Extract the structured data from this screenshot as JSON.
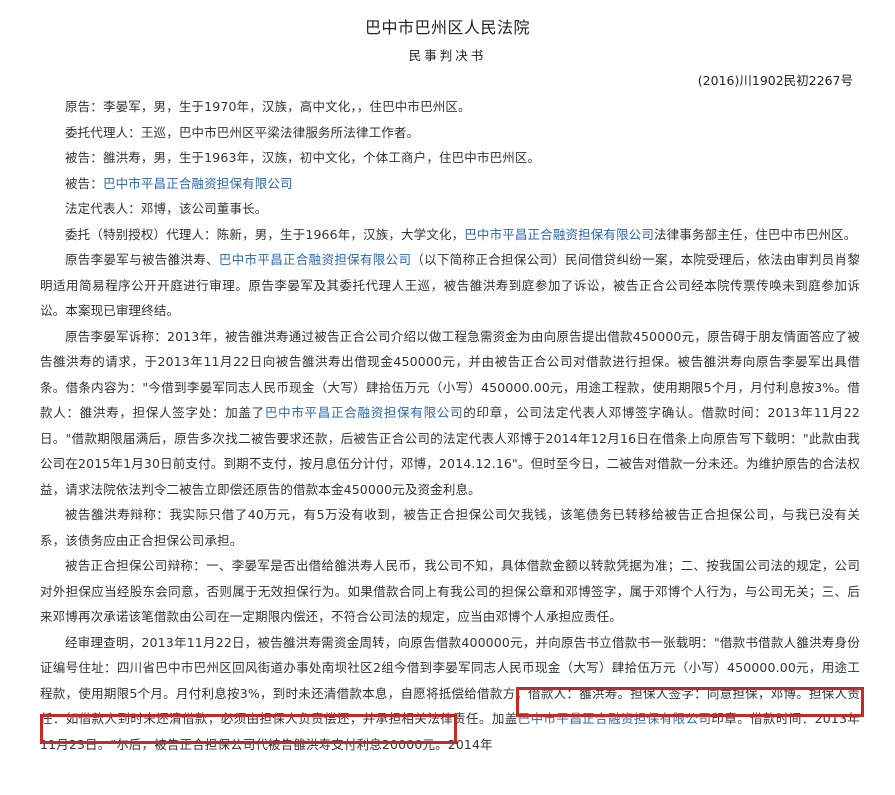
{
  "header": {
    "court": "巴中市巴州区人民法院",
    "doc_type": "民事判决书",
    "case_no": "(2016)川1902民初2267号"
  },
  "parties": {
    "p1": "原告：李晏军，男，生于1970年，汉族，高中文化，，住巴中市巴州区。",
    "p2": "委托代理人：王巡，巴中市巴州区平梁法律服务所法律工作者。",
    "p3": "被告：雒洪寿，男，生于1963年，汉族，初中文化，个体工商户，住巴中市巴州区。",
    "p4_a": "被告：",
    "company": "巴中市平昌正合融资担保有限公司",
    "p5": "法定代表人：邓博，该公司董事长。",
    "p6_a": "委托（特别授权）代理人：陈新，男，生于1966年，汉族，大学文化，",
    "p6_b": "法律事务部主任，住巴中市巴州区。"
  },
  "paragraphs": {
    "p7_a": "原告李晏军与被告雒洪寿、",
    "p7_b": "（以下简称正合担保公司）民间借贷纠纷一案，本院受理后，依法由审判员肖黎明适用简易程序公开开庭进行审理。原告李晏军及其委托代理人王巡，被告雒洪寿到庭参加了诉讼，被告正合公司经本院传票传唤未到庭参加诉讼。本案现已审理终结。",
    "p8_a": "原告李晏军诉称：2013年，被告雒洪寿通过被告正合公司介绍以做工程急需资金为由向原告提出借款450000元，原告碍于朋友情面答应了被告雒洪寿的请求，于2013年11月22日向被告雒洪寿出借现金450000元，并由被告正合公司对借款进行担保。被告雒洪寿向原告李晏军出具借条。借条内容为：\"今借到李晏军同志人民币现金（大写）肆拾伍万元（小写）450000.00元，用途工程款，使用期限5个月，月付利息按3%。借款人：雒洪寿，担保人签字处：加盖了",
    "p8_b": "的印章，公司法定代表人邓博签字确认。借款时间：2013年11月22日。\"借款期限届满后，原告多次找二被告要求还款，后被告正合公司的法定代表人邓博于2014年12月16日在借条上向原告写下载明：\"此款由我公司在2015年1月30日前支付。到期不支付，按月息伍分计付，邓博，2014.12.16\"。但时至今日，二被告对借款一分未还。为维护原告的合法权益，请求法院依法判令二被告立即偿还原告的借款本金450000元及资金利息。",
    "p9": "被告雒洪寿辩称：我实际只借了40万元，有5万没有收到，被告正合担保公司欠我钱，该笔债务已转移给被告正合担保公司，与我已没有关系，该债务应由正合担保公司承担。",
    "p10": "被告正合担保公司辩称：一、李晏军是否出借给雒洪寿人民币，我公司不知，具体借款金额以转款凭据为准；二、按我国公司法的规定，公司对外担保应当经股东会同意，否则属于无效担保行为。如果借款合同上有我公司的担保公章和邓博签字，属于邓博个人行为，与公司无关；三、后来邓博再次承诺该笔借款由公司在一定期限内偿还，不符合公司法的规定，应当由邓博个人承担应责任。",
    "p11_a": "经审理查明，2013年11月22日，被告雒洪寿需资金周转，向原告借款400000元，并向原告书立借款书一张载明：\"借款书借款人雒洪寿身份证编号住址：四川省巴中市巴州区回风街道办事处南坝社区2组今借到李晏军同志人民币现金（大写）肆拾伍万元（小写）450000.00元，用途工程款，使用期限5个月。月付利息按3%，到时未还清借款本息，自愿将抵偿给借款方。借款人：雒洪寿。担保人签字：同意担保，邓博。担保人责任：如借款人到时未还清借款，必须由担保人负责偿还，并承担相关法律责任。加盖",
    "p11_b": "印章。借款时间：2013年11月23日。\"尔后，被告正合担保公司代被告雒洪寿支付利息20000元。2014年"
  }
}
